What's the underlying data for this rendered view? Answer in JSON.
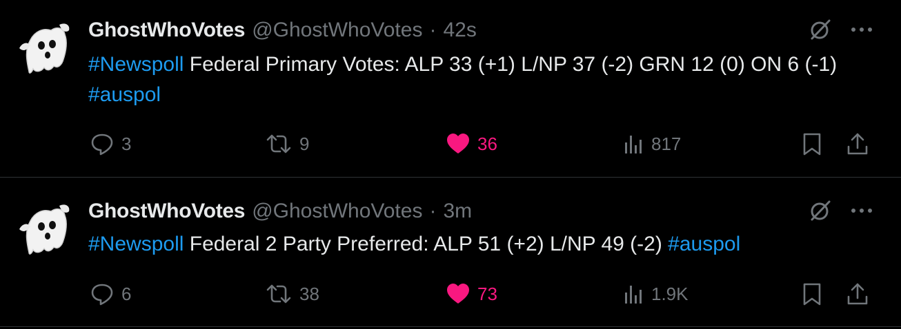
{
  "tweets": [
    {
      "author_name": "GhostWhoVotes",
      "handle": "@GhostWhoVotes",
      "separator": "·",
      "time": "42s",
      "segments": [
        {
          "text": "#Newspoll",
          "type": "hashtag"
        },
        {
          "text": " Federal Primary Votes: ALP 33 (+1) L/NP 37 (-2) GRN 12 (0) ON 6 (-1) ",
          "type": "text"
        },
        {
          "text": "#auspol",
          "type": "hashtag"
        }
      ],
      "replies": "3",
      "retweets": "9",
      "likes": "36",
      "views": "817",
      "liked": true
    },
    {
      "author_name": "GhostWhoVotes",
      "handle": "@GhostWhoVotes",
      "separator": "·",
      "time": "3m",
      "segments": [
        {
          "text": "#Newspoll",
          "type": "hashtag"
        },
        {
          "text": " Federal 2 Party Preferred: ALP 51 (+2) L/NP 49 (-2) ",
          "type": "text"
        },
        {
          "text": "#auspol",
          "type": "hashtag"
        }
      ],
      "replies": "6",
      "retweets": "38",
      "likes": "73",
      "views": "1.9K",
      "liked": true
    }
  ],
  "icons": {
    "avatar": "ghost-avatar-icon",
    "grok": "grok-icon",
    "more": "more-horizontal-icon",
    "reply": "reply-icon",
    "retweet": "retweet-icon",
    "like": "heart-icon",
    "views": "views-icon",
    "bookmark": "bookmark-icon",
    "share": "share-icon"
  },
  "colors": {
    "background": "#000000",
    "text": "#e7e9ea",
    "muted": "#71767b",
    "hashtag": "#1d9bf0",
    "like": "#f91880",
    "divider": "#2f3336"
  }
}
